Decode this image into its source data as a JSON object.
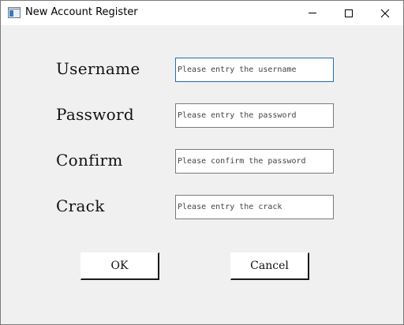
{
  "window": {
    "title": "New Account Register",
    "icon": "app-window-icon"
  },
  "form": {
    "username_label": "Username",
    "username_placeholder": "Please entry the username",
    "password_label": "Password",
    "password_placeholder": "Please entry the password",
    "confirm_label": "Confirm",
    "confirm_placeholder": "Please confirm the password",
    "crack_label": "Crack",
    "crack_placeholder": "Please entry the crack"
  },
  "buttons": {
    "ok_label": "OK",
    "cancel_label": "Cancel"
  },
  "colors": {
    "focus_border": "#1f6fb8",
    "window_bg": "#f0f0f0"
  }
}
